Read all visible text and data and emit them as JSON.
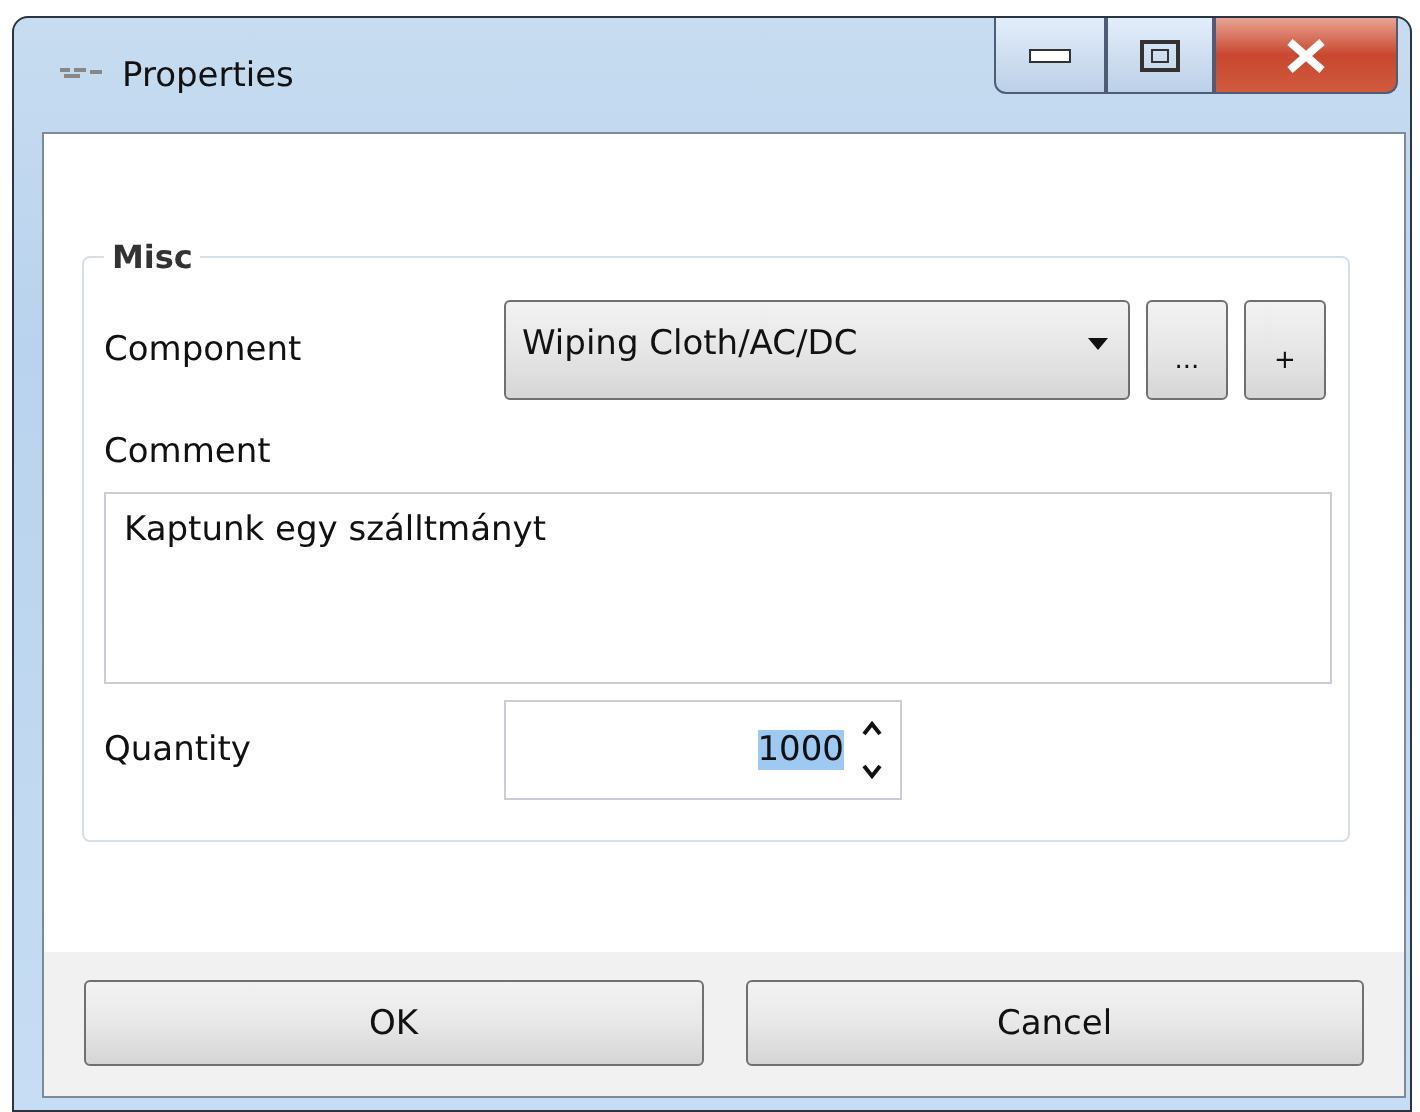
{
  "window": {
    "title": "Properties"
  },
  "group": {
    "title": "Misc",
    "component": {
      "label": "Component",
      "value": "Wiping Cloth/AC/DC",
      "browse_button": "...",
      "add_button": "+"
    },
    "comment": {
      "label": "Comment",
      "value": "Kaptunk egy szálltmányt"
    },
    "quantity": {
      "label": "Quantity",
      "value": "1000",
      "value_selected": true
    }
  },
  "buttons": [
    {
      "label": "OK"
    },
    {
      "label": "Cancel"
    }
  ]
}
